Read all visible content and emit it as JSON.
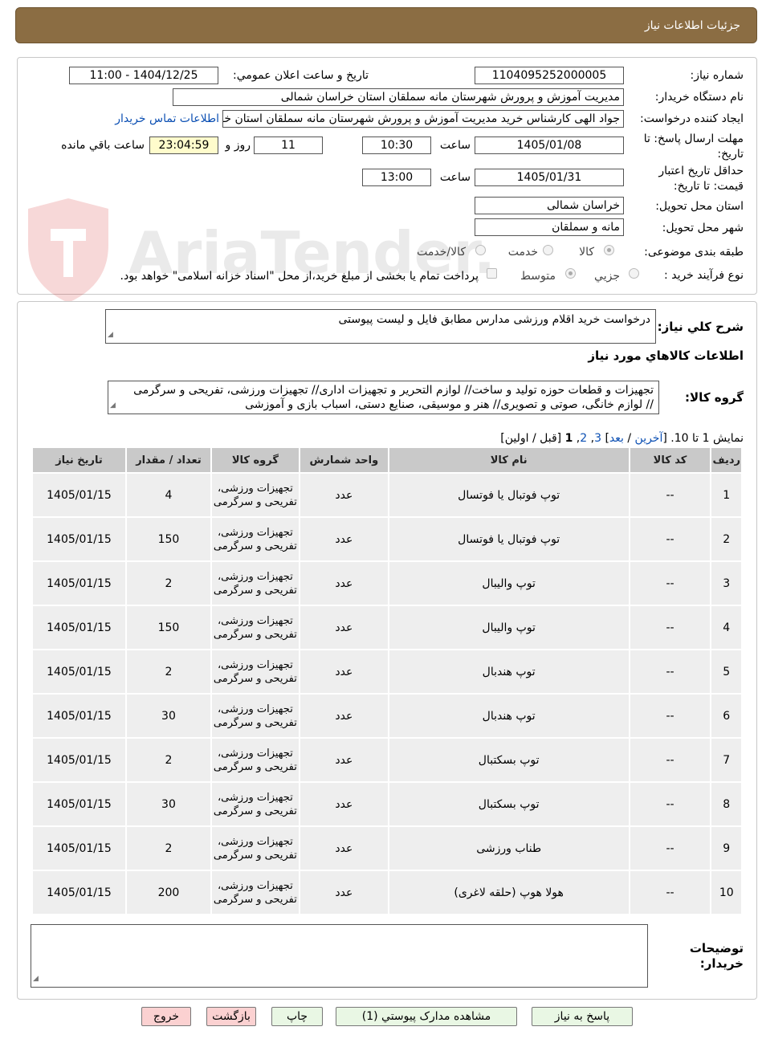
{
  "header": {
    "title": "جزئیات اطلاعات نیاز"
  },
  "form": {
    "need_number_label": "شماره نیاز:",
    "need_number": "1104095252000005",
    "announce_label": "تاریخ و ساعت اعلان عمومي:",
    "announce_value": "1404/12/25 - 11:00",
    "buyer_org_label": "نام دستگاه خریدار:",
    "buyer_org": "مدیریت آموزش و پرورش شهرستان مانه سملقان استان خراسان شمالی",
    "requester_label": "ایجاد کننده درخواست:",
    "requester": "جواد الهی کارشناس خرید مدیریت آموزش و پرورش شهرستان مانه سملقان استان خراسان شمالی",
    "contact_link": "اطلاعات تماس خریدار",
    "deadline_label": "مهلت ارسال پاسخ: تا تاریخ:",
    "deadline_date": "1405/01/08",
    "time_label": "ساعت",
    "deadline_time": "10:30",
    "days_value": "11",
    "days_label": "روز و",
    "remaining_time": "23:04:59",
    "remaining_label": "ساعت باقي مانده",
    "validity_label": "حداقل تاریخ اعتبار قیمت: تا تاریخ:",
    "validity_date": "1405/01/31",
    "validity_time": "13:00",
    "province_label": "استان محل تحویل:",
    "province": "خراسان شمالی",
    "city_label": "شهر محل تحویل:",
    "city": "مانه و سملقان",
    "category_label": "طبقه بندی موضوعی:",
    "category_options": [
      "کالا",
      "خدمت",
      "کالا/خدمت"
    ],
    "category_selected": "کالا",
    "process_label": "نوع فرآیند خرید :",
    "process_options": [
      "جزیي",
      "متوسط"
    ],
    "process_selected": "متوسط",
    "payment_note": "پرداخت تمام یا بخشی از مبلغ خرید،از محل \"اسناد خزانه اسلامی\" خواهد بود."
  },
  "watermark": {
    "text": "AriaTender.neT"
  },
  "description": {
    "label": "شرح کلي نیاز:",
    "value": "درخواست خرید اقلام ورزشی مدارس مطابق فایل و لیست پیوستی"
  },
  "goods_info": {
    "heading": "اطلاعات کالاهاي مورد نیاز",
    "group_label": "گروه کالا:",
    "group_line1": "تجهیزات و قطعات حوزه تولید و ساخت// لوازم التحریر و تجهیزات اداری// تجهیزات ورزشی، تفریحی و سرگرمی",
    "group_line2": "// لوازم خانگی، صوتی و تصویری// هنر و موسیقی، صنایع دستی، اسباب بازی و آموزشی"
  },
  "pagination": {
    "prefix": "نمایش 1 تا 10.",
    "open_bracket": "[",
    "last": "آخرین",
    "sep1": "/",
    "next": "بعد",
    "close_bracket": "]",
    "page3": "3",
    "comma1": ",",
    "page2": "2",
    "comma2": ",",
    "current": "1",
    "tail": "[قبل / اولین]"
  },
  "table": {
    "headers": [
      "ردیف",
      "کد کالا",
      "نام کالا",
      "واحد شمارش",
      "گروه کالا",
      "تعداد / مقدار",
      "تاریخ نیاز"
    ],
    "rows": [
      {
        "row": "1",
        "code": "--",
        "name": "توپ فوتبال یا فوتسال",
        "unit": "عدد",
        "group": "تجهیزات ورزشی، تفریحی و سرگرمی",
        "qty": "4",
        "date": "1405/01/15"
      },
      {
        "row": "2",
        "code": "--",
        "name": "توپ فوتبال یا فوتسال",
        "unit": "عدد",
        "group": "تجهیزات ورزشی، تفریحی و سرگرمی",
        "qty": "150",
        "date": "1405/01/15"
      },
      {
        "row": "3",
        "code": "--",
        "name": "توپ والیبال",
        "unit": "عدد",
        "group": "تجهیزات ورزشی، تفریحی و سرگرمی",
        "qty": "2",
        "date": "1405/01/15"
      },
      {
        "row": "4",
        "code": "--",
        "name": "توپ والیبال",
        "unit": "عدد",
        "group": "تجهیزات ورزشی، تفریحی و سرگرمی",
        "qty": "150",
        "date": "1405/01/15"
      },
      {
        "row": "5",
        "code": "--",
        "name": "توپ هندبال",
        "unit": "عدد",
        "group": "تجهیزات ورزشی، تفریحی و سرگرمی",
        "qty": "2",
        "date": "1405/01/15"
      },
      {
        "row": "6",
        "code": "--",
        "name": "توپ هندبال",
        "unit": "عدد",
        "group": "تجهیزات ورزشی، تفریحی و سرگرمی",
        "qty": "30",
        "date": "1405/01/15"
      },
      {
        "row": "7",
        "code": "--",
        "name": "توپ بسکتبال",
        "unit": "عدد",
        "group": "تجهیزات ورزشی، تفریحی و سرگرمی",
        "qty": "2",
        "date": "1405/01/15"
      },
      {
        "row": "8",
        "code": "--",
        "name": "توپ بسکتبال",
        "unit": "عدد",
        "group": "تجهیزات ورزشی، تفریحی و سرگرمی",
        "qty": "30",
        "date": "1405/01/15"
      },
      {
        "row": "9",
        "code": "--",
        "name": "طناب ورزشی",
        "unit": "عدد",
        "group": "تجهیزات ورزشی، تفریحی و سرگرمی",
        "qty": "2",
        "date": "1405/01/15"
      },
      {
        "row": "10",
        "code": "--",
        "name": "هولا هوپ (حلقه لاغری)",
        "unit": "عدد",
        "group": "تجهیزات ورزشی، تفریحی و سرگرمی",
        "qty": "200",
        "date": "1405/01/15"
      }
    ]
  },
  "buyer_notes": {
    "label": "توضیحات خریدار:",
    "value": ""
  },
  "buttons": {
    "reply": "پاسخ به نیاز",
    "attachments": "مشاهده مدارک پیوستي (1)",
    "print": "چاپ",
    "back": "بازگشت",
    "exit": "خروج"
  },
  "colors": {
    "header_bg": "#8b6d43",
    "table_header": "#c9c9c9",
    "table_cell": "#eeeeee",
    "remaining_bg": "#fffccc",
    "link": "#0b4fb3"
  }
}
